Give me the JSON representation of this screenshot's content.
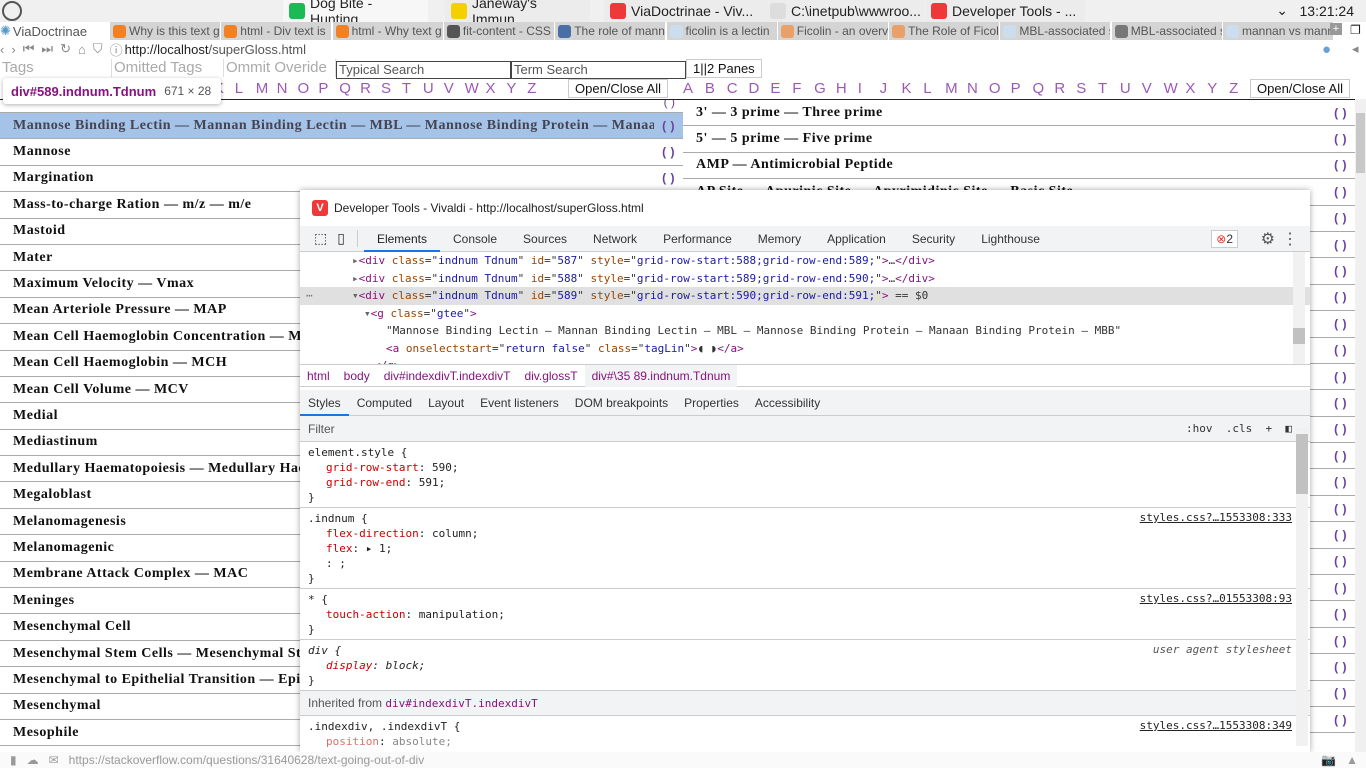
{
  "os_tabs": [
    {
      "label": "ViaDoctrinae",
      "icon": "vivaldi-logo-icon"
    },
    {
      "label": "Dog Bite - Hunting...",
      "icon": "spotify-icon",
      "color": "#1db954"
    },
    {
      "label": "Janeway's Immun...",
      "icon": "pdf-icon",
      "color": "#f5d000"
    },
    {
      "label": "ViaDoctrinae - Viv...",
      "icon": "vivaldi-icon",
      "color": "#ef3939"
    },
    {
      "label": "C:\\inetpub\\wwwroo...",
      "icon": "notepad-icon"
    },
    {
      "label": "Developer Tools - ...",
      "icon": "vivaldi-icon",
      "color": "#ef3939"
    }
  ],
  "clock": "13:21:24",
  "browser_name": "ViaDoctrinae",
  "browser_tabs": [
    "Why is this text g",
    "html - Div text is",
    "html - Why text g",
    "fit-content - CSS",
    "The role of mann",
    "ficolin is a lectin",
    "Ficolin - an overv",
    "The Role of Ficoli",
    "MBL-associated s",
    "MBL-associated s",
    "mannan vs mann"
  ],
  "address": {
    "url_host": "http://localhost",
    "url_path": "/superGloss.html"
  },
  "controls": {
    "tags": "Tags",
    "omitted_tags": "Omitted Tags",
    "omit_override": "Ommit Overide",
    "typical_search_placeholder": "Typical Search",
    "term_search_placeholder": "Term Search",
    "panes_button": "1||2 Panes",
    "open_close_all": "Open/Close All"
  },
  "alphabet": [
    "A",
    "B",
    "C",
    "D",
    "E",
    "F",
    "G",
    "H",
    "I",
    "J",
    "K",
    "L",
    "M",
    "N",
    "O",
    "P",
    "Q",
    "R",
    "S",
    "T",
    "U",
    "V",
    "W",
    "X",
    "Y",
    "Z"
  ],
  "tooltip": {
    "selector": "div#589.indnum.Tdnum",
    "dims": "671 × 28"
  },
  "left_terms": [
    "Mannose Binding Lectin — Mannan Binding Lectin — MBL — Mannose Binding Protein — Manaan Binding Protein — MBB",
    "Mannose",
    "Margination",
    "Mass-to-charge Ration — m/z — m/e",
    "Mastoid",
    "Mater",
    "Maximum Velocity — Vmax",
    "Mean Arteriole Pressure — MAP",
    "Mean Cell Haemoglobin Concentration — MCHC",
    "Mean Cell Haemoglobin — MCH",
    "Mean Cell Volume — MCV",
    "Medial",
    "Mediastinum",
    "Medullary Haematopoiesis — Medullary Haematopoiesis",
    "Megaloblast",
    "Melanomagenesis",
    "Melanomagenic",
    "Membrane Attack Complex — MAC",
    "Meninges",
    "Mesenchymal Cell",
    "Mesenchymal Stem Cells — Mesenchymal Stromal Cells",
    "Mesenchymal to Epithelial Transition — Epithelial",
    "Mesenchymal",
    "Mesophile"
  ],
  "right_terms": [
    "3' — 3 prime — Three prime",
    "5' — 5 prime — Five prime",
    "AMP — Antimicrobial Peptide",
    "AP Site — Apurinic Site — Apyrimidinic Site — Basic Site",
    "",
    "",
    "",
    "",
    "",
    "",
    "",
    "",
    "",
    "",
    "",
    "",
    "",
    "",
    "",
    "",
    "",
    "",
    "",
    ""
  ],
  "paren": "( )",
  "devtools": {
    "title": "Developer Tools - Vivaldi - http://localhost/superGloss.html",
    "tabs": [
      "Elements",
      "Console",
      "Sources",
      "Network",
      "Performance",
      "Memory",
      "Application",
      "Security",
      "Lighthouse"
    ],
    "error_count": "2",
    "elements": [
      {
        "id": "587",
        "style": "grid-row-start:588;grid-row-end:589;"
      },
      {
        "id": "588",
        "style": "grid-row-start:589;grid-row-end:590;"
      },
      {
        "id": "589",
        "style": "grid-row-start:590;grid-row-end:591;"
      }
    ],
    "div_class": "indnum Tdnum",
    "selected_marker": "== $0",
    "g_class": "gtee",
    "text_node": "\"Mannose Binding Lectin — Mannan Binding Lectin — MBL — Mannose Binding Protein — Manaan Binding Protein — MBB\"",
    "a_onselectstart": "return false",
    "a_class": "tagLin",
    "breadcrumbs": [
      "html",
      "body",
      "div#indexdivT.indexdivT",
      "div.glossT",
      "div#\\35 89.indnum.Tdnum"
    ],
    "style_tabs": [
      "Styles",
      "Computed",
      "Layout",
      "Event listeners",
      "DOM breakpoints",
      "Properties",
      "Accessibility"
    ],
    "filter_placeholder": "Filter",
    "hov": ":hov",
    "cls": ".cls",
    "rules": [
      {
        "selector": "element.style {",
        "source": "",
        "props": [
          [
            "grid-row-start",
            "590;"
          ],
          [
            "grid-row-end",
            "591;"
          ]
        ]
      },
      {
        "selector": ".indnum {",
        "source": "styles.css?…1553308:333",
        "props": [
          [
            "flex-direction",
            "column;"
          ],
          [
            "flex",
            "▸ 1;"
          ],
          [
            "",
            ": ;"
          ]
        ]
      },
      {
        "selector": "* {",
        "source": "styles.css?…01553308:93",
        "props": [
          [
            "touch-action",
            "manipulation;"
          ]
        ]
      },
      {
        "selector": "div {",
        "source": "user agent stylesheet",
        "props": [
          [
            "display",
            "block;"
          ]
        ]
      }
    ],
    "inherited_label": "Inherited from",
    "inherited_from": "div#indexdivT.indexdivT",
    "last_rule": {
      "selector": ".indexdiv, .indexdivT {",
      "source": "styles.css?…1553308:349",
      "prop": "position",
      "value": "absolute;"
    }
  },
  "status_url": "https://stackoverflow.com/questions/31640628/text-going-out-of-div"
}
